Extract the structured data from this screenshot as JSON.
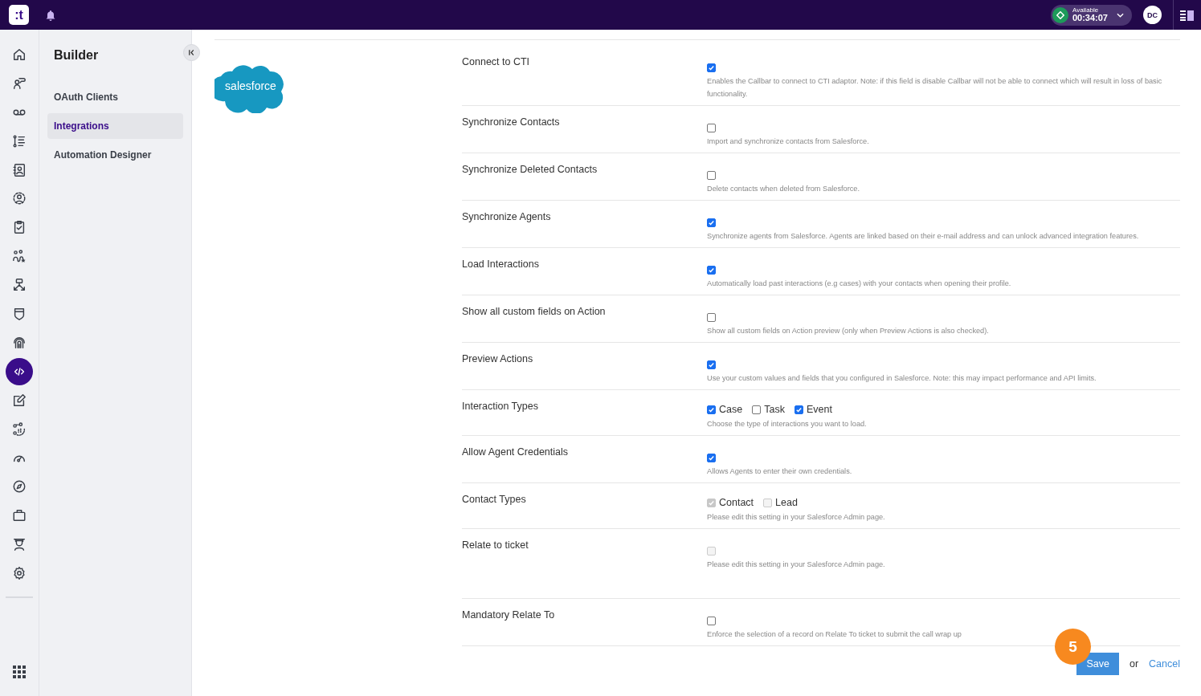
{
  "topbar": {
    "logo": ":t",
    "status": {
      "label": "Available",
      "timer": "00:34:07"
    },
    "avatar": "DC"
  },
  "rail": [
    {
      "selected": false
    },
    {
      "selected": false
    },
    {
      "selected": false
    },
    {
      "selected": false
    },
    {
      "selected": false
    },
    {
      "selected": false
    },
    {
      "selected": false
    },
    {
      "selected": false
    },
    {
      "selected": false
    },
    {
      "selected": false
    },
    {
      "selected": false
    },
    {
      "selected": true
    },
    {
      "selected": false
    },
    {
      "selected": false
    },
    {
      "selected": false
    },
    {
      "selected": false
    },
    {
      "selected": false
    },
    {
      "selected": false
    },
    {
      "selected": false
    }
  ],
  "sidebar": {
    "title": "Builder",
    "items": [
      {
        "label": "OAuth Clients",
        "selected": false
      },
      {
        "label": "Integrations",
        "selected": true
      },
      {
        "label": "Automation Designer",
        "selected": false
      }
    ]
  },
  "integration": {
    "logo_text": "salesforce"
  },
  "settings": [
    {
      "label": "Connect to CTI",
      "kind": "checkbox",
      "checked": true,
      "disabled": false,
      "description": "Enables the Callbar to connect to CTI adaptor. Note: if this field is disable Callbar will not be able to connect which will result in loss of basic functionality."
    },
    {
      "label": "Synchronize Contacts",
      "kind": "checkbox",
      "checked": false,
      "disabled": false,
      "description": "Import and synchronize contacts from Salesforce."
    },
    {
      "label": "Synchronize Deleted Contacts",
      "kind": "checkbox",
      "checked": false,
      "disabled": false,
      "description": "Delete contacts when deleted from Salesforce."
    },
    {
      "label": "Synchronize Agents",
      "kind": "checkbox",
      "checked": true,
      "disabled": false,
      "description": "Synchronize agents from Salesforce. Agents are linked based on their e-mail address and can unlock advanced integration features."
    },
    {
      "label": "Load Interactions",
      "kind": "checkbox",
      "checked": true,
      "disabled": false,
      "description": "Automatically load past interactions (e.g cases) with your contacts when opening their profile."
    },
    {
      "label": "Show all custom fields on Action",
      "kind": "checkbox",
      "checked": false,
      "disabled": false,
      "description": "Show all custom fields on Action preview (only when Preview Actions is also checked)."
    },
    {
      "label": "Preview Actions",
      "kind": "checkbox",
      "checked": true,
      "disabled": false,
      "description": "Use your custom values and fields that you configured in Salesforce. Note: this may impact performance and API limits."
    },
    {
      "label": "Interaction Types",
      "kind": "options",
      "options": [
        {
          "label": "Case",
          "checked": true,
          "disabled": false
        },
        {
          "label": "Task",
          "checked": false,
          "disabled": false
        },
        {
          "label": "Event",
          "checked": true,
          "disabled": false
        }
      ],
      "description": "Choose the type of interactions you want to load."
    },
    {
      "label": "Allow Agent Credentials",
      "kind": "checkbox",
      "checked": true,
      "disabled": false,
      "description": "Allows Agents to enter their own credentials."
    },
    {
      "label": "Contact Types",
      "kind": "options",
      "options": [
        {
          "label": "Contact",
          "checked": true,
          "disabled": true
        },
        {
          "label": "Lead",
          "checked": false,
          "disabled": true
        }
      ],
      "description": "Please edit this setting in your Salesforce Admin page."
    },
    {
      "label": "Relate to ticket",
      "kind": "checkbox",
      "checked": false,
      "disabled": true,
      "description": "Please edit this setting in your Salesforce Admin page."
    },
    {
      "label": "Mandatory Relate To",
      "kind": "checkbox",
      "checked": false,
      "disabled": false,
      "description": "Enforce the selection of a record on Relate To ticket to submit the call wrap up"
    }
  ],
  "footer": {
    "save": "Save",
    "or": "or",
    "cancel": "Cancel"
  },
  "step_badge": "5"
}
